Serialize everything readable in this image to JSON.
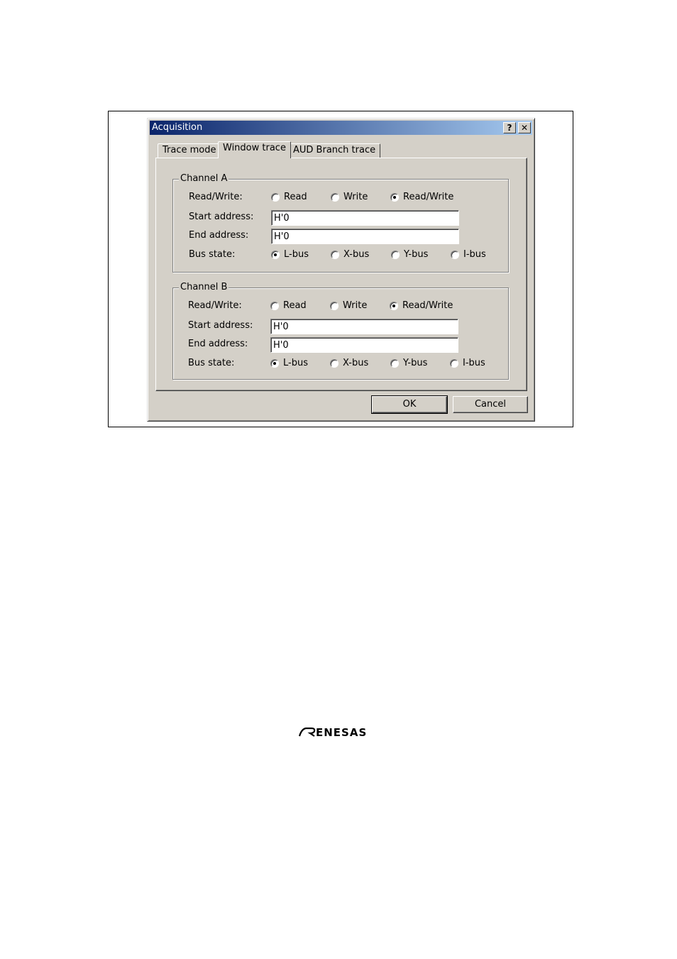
{
  "dialog": {
    "title": "Acquisition",
    "help_label": "?",
    "close_label": "✕",
    "tabs": [
      {
        "label": "Trace mode"
      },
      {
        "label": "Window trace"
      },
      {
        "label": "AUD Branch trace"
      }
    ],
    "channel_a": {
      "legend": "Channel A",
      "rw_label": "Read/Write:",
      "rw_options": {
        "read": "Read",
        "write": "Write",
        "readwrite": "Read/Write"
      },
      "rw_selected": "Read/Write",
      "start_label": "Start address:",
      "start_value": "H'0",
      "end_label": "End address:",
      "end_value": "H'0",
      "bus_label": "Bus state:",
      "bus_options": {
        "l": "L-bus",
        "x": "X-bus",
        "y": "Y-bus",
        "i": "I-bus"
      },
      "bus_selected": "L-bus"
    },
    "channel_b": {
      "legend": "Channel B",
      "rw_label": "Read/Write:",
      "rw_options": {
        "read": "Read",
        "write": "Write",
        "readwrite": "Read/Write"
      },
      "rw_selected": "Read/Write",
      "start_label": "Start address:",
      "start_value": "H'0",
      "end_label": "End address:",
      "end_value": "H'0",
      "bus_label": "Bus state:",
      "bus_options": {
        "l": "L-bus",
        "x": "X-bus",
        "y": "Y-bus",
        "i": "I-bus"
      },
      "bus_selected": "L-bus"
    },
    "ok_label": "OK",
    "cancel_label": "Cancel"
  },
  "logo": {
    "text": "RENESAS",
    "icon": "renesas-logo"
  }
}
